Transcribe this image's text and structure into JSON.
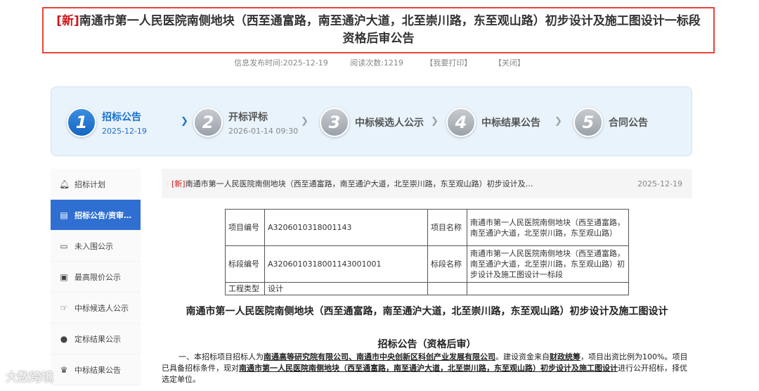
{
  "header": {
    "tag": "[新]",
    "title": "南通市第一人民医院南侧地块（西至通富路，南至通沪大道，北至崇川路，东至观山路）初步设计及施工图设计一标段资格后审公告"
  },
  "meta": {
    "publish_time": "信息发布时间:2025-12-19",
    "views": "阅读次数:1219",
    "print": "【我要打印】",
    "close": "【关闭】"
  },
  "progress": {
    "steps": [
      {
        "num": "1",
        "name": "招标公告",
        "date": "2025-12-19",
        "active": true
      },
      {
        "num": "2",
        "name": "开标评标",
        "date": "2026-01-14 09:30",
        "active": false
      },
      {
        "num": "3",
        "name": "中标候选人公示",
        "date": "",
        "active": false
      },
      {
        "num": "4",
        "name": "中标结果公告",
        "date": "",
        "active": false
      },
      {
        "num": "5",
        "name": "合同公告",
        "date": "",
        "active": false
      }
    ]
  },
  "sidebar": {
    "items": [
      {
        "label": "招标计划",
        "icon": "bell-icon"
      },
      {
        "label": "招标公告/资审…",
        "icon": "document-icon",
        "active": true
      },
      {
        "label": "未入围公示",
        "icon": "briefcase-icon"
      },
      {
        "label": "最高限价公示",
        "icon": "price-tag-icon"
      },
      {
        "label": "中标候选人公示",
        "icon": "hand-pointer-icon"
      },
      {
        "label": "定标结果公示",
        "icon": "user-icon"
      },
      {
        "label": "中标结果公告",
        "icon": "trophy-icon"
      }
    ]
  },
  "content": {
    "tag": "[新]",
    "title": "南通市第一人民医院南侧地块（西至通富路，南至通沪大道，北至崇川路，东至观山路）初步设计及…",
    "date": "2025-12-19"
  },
  "info_table": {
    "project_no_label": "项目编号",
    "project_no": "A3206010318001143",
    "project_name_label": "项目名称",
    "project_name": "南通市第一人民医院南侧地块（西至通富路，南至通沪大道，北至崇川路，东至观山路）",
    "section_no_label": "标段编号",
    "section_no": "A3206010318001143001001",
    "section_name_label": "标段名称",
    "section_name": "南通市第一人民医院南侧地块（西至通富路，南至通沪大道，北至崇川路，东至观山路）初步设计及施工图设计一标段",
    "type_label": "工程类型",
    "type": "设计"
  },
  "document": {
    "title": "南通市第一人民医院南侧地块（西至通富路，南至通沪大道，北至崇川路，东至观山路）初步设计及施工图设计",
    "subtitle": "招标公告（资格后审）",
    "p1_a": "一、本招标项目招标人为",
    "p1_b": "南通高等研究院有限公司、南通市中央创新区科创产业发展有限公司",
    "p1_c": "。建设资金来自",
    "p1_d": "财政统筹",
    "p1_e": "，项目出资比例为100%。项目已具备招标条件，现对",
    "p1_f": "南通市第一人民医院南侧地块（西至通富路，南至通沪大道，北至崇川路，东至观山路）初步设计及施工图设计",
    "p1_g": "进行公开招标，择优选定单位。"
  },
  "watermark": "大数跨境",
  "colors": {
    "accent": "#2f6fd1",
    "highlight_border": "#e8443a",
    "new_tag": "#d0191b"
  }
}
